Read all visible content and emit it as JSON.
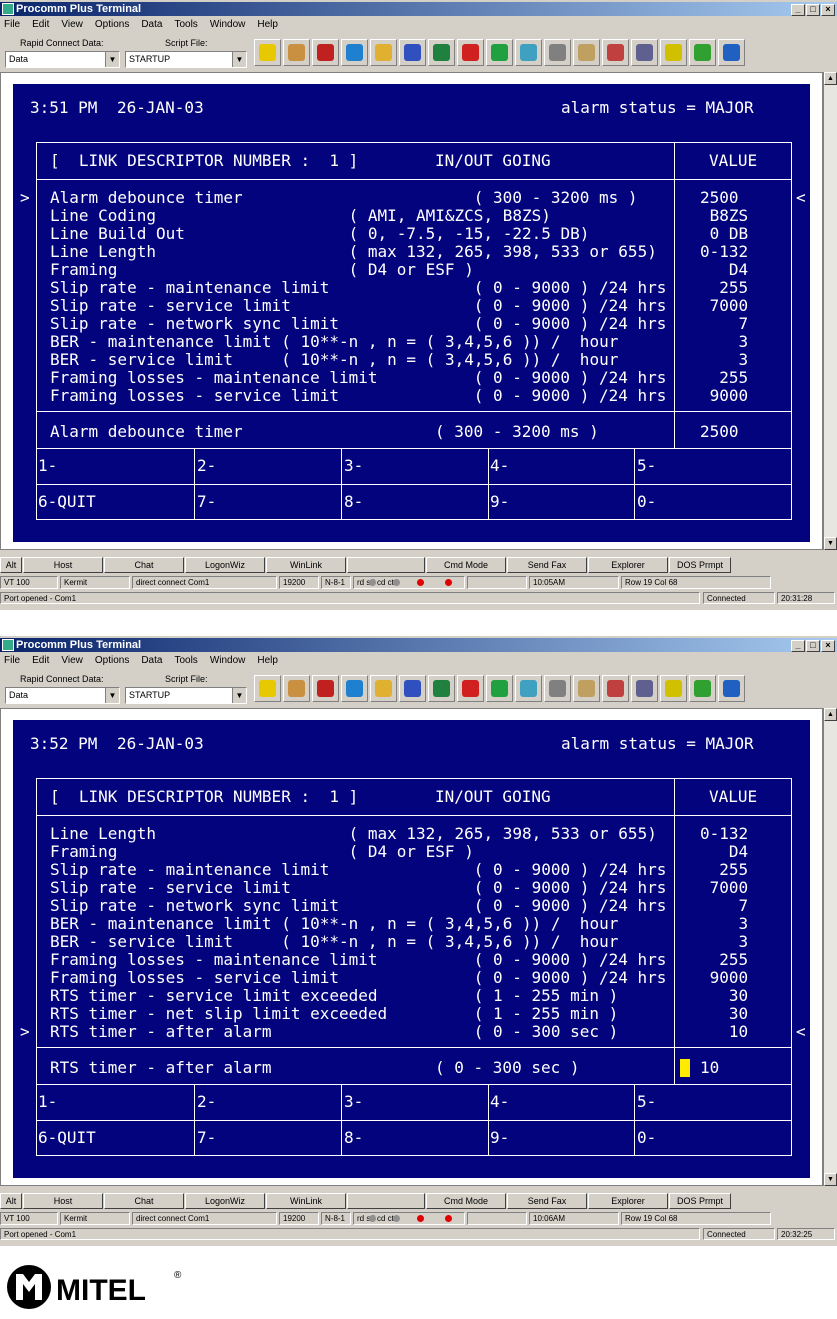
{
  "app": {
    "title": "Procomm Plus Terminal"
  },
  "menu": [
    "File",
    "Edit",
    "View",
    "Options",
    "Data",
    "Tools",
    "Window",
    "Help"
  ],
  "toolbar": {
    "rapid_label": "Rapid Connect Data:",
    "rapid_value": "Data",
    "script_label": "Script File:",
    "script_value": "STARTUP",
    "tools": [
      "run-script-icon",
      "phonebook-icon",
      "mode-icon",
      "upload-icon",
      "download-icon",
      "send-file-icon",
      "capture-icon",
      "dial-icon",
      "terminal-icon",
      "connect-icon",
      "printer-icon",
      "basket-icon",
      "pen-icon",
      "capture-file-icon",
      "meta-key-icon",
      "chat-icon",
      "internet-icon"
    ]
  },
  "colors": {
    "terminal_bg": "#03037e",
    "terminal_fg": "#ffffff",
    "cursor": "#ffeb00",
    "titlebar": "#0a246a"
  },
  "actionbar": {
    "alt_label": "Alt",
    "buttons": [
      "Host",
      "Chat",
      "LogonWiz",
      "WinLink",
      "",
      "Cmd Mode",
      "Send Fax",
      "Explorer",
      "DOS Prmpt"
    ]
  },
  "screens": [
    {
      "time": "3:51 PM",
      "date": "26-JAN-03",
      "alarm_status": "alarm status = MAJOR",
      "header_left": "[  LINK DESCRIPTOR NUMBER :  1 ]",
      "header_mid": "IN/OUT GOING",
      "header_value": "VALUE",
      "marker_left": ">",
      "marker_right": "<",
      "rows": [
        {
          "label": "Alarm debounce timer",
          "range": "                        ( 300 - 3200 ms )",
          "value": "2500"
        },
        {
          "label": "Line Coding",
          "range": "                    ( AMI, AMI&ZCS, B8ZS)",
          "value": " B8ZS"
        },
        {
          "label": "Line Build Out",
          "range": "                 ( 0, -7.5, -15, -22.5 DB)",
          "value": " 0 DB"
        },
        {
          "label": "Line Length",
          "range": "                    ( max 132, 265, 398, 533 or 655)",
          "value": "0-132"
        },
        {
          "label": "Framing",
          "range": "                        ( D4 or ESF )",
          "value": "   D4"
        },
        {
          "label": "Slip rate - maintenance limit",
          "range": "               ( 0 - 9000 ) /24 hrs",
          "value": "  255"
        },
        {
          "label": "Slip rate - service limit",
          "range": "                   ( 0 - 9000 ) /24 hrs",
          "value": " 7000"
        },
        {
          "label": "Slip rate - network sync limit",
          "range": "              ( 0 - 9000 ) /24 hrs",
          "value": "    7"
        },
        {
          "label": "BER - maintenance limit ( 10**-n , n = ( 3,4,5,6 )) /  hour",
          "range": "",
          "value": "    3"
        },
        {
          "label": "BER - service limit     ( 10**-n , n = ( 3,4,5,6 )) /  hour",
          "range": "",
          "value": "    3"
        },
        {
          "label": "Framing losses - maintenance limit",
          "range": "          ( 0 - 9000 ) /24 hrs",
          "value": "  255"
        },
        {
          "label": "Framing losses - service limit",
          "range": "              ( 0 - 9000 ) /24 hrs",
          "value": " 9000"
        }
      ],
      "marker_row": 0,
      "edit_label": "Alarm debounce timer",
      "edit_range": "( 300 - 3200 ms )",
      "edit_value": "2500",
      "show_cursor": false,
      "softkeys": [
        "1-",
        "2-",
        "3-",
        "4-",
        "5-",
        "6-QUIT",
        "7-",
        "8-",
        "9-",
        "0-"
      ],
      "status": {
        "emulation": "VT 100",
        "protocol": "Kermit",
        "connection": "direct connect Com1",
        "baud": "19200",
        "parity": "N-8-1",
        "leds": "rd      sd      cd      cts",
        "clock": "10:05AM",
        "position": "Row 19   Col 68",
        "port": "Port opened - Com1",
        "state": "Connected",
        "elapsed": "20:31:28"
      }
    },
    {
      "time": "3:52 PM",
      "date": "26-JAN-03",
      "alarm_status": "alarm status = MAJOR",
      "header_left": "[  LINK DESCRIPTOR NUMBER :  1 ]",
      "header_mid": "IN/OUT GOING",
      "header_value": "VALUE",
      "marker_left": ">",
      "marker_right": "<",
      "rows": [
        {
          "label": "Line Length",
          "range": "                    ( max 132, 265, 398, 533 or 655)",
          "value": "0-132"
        },
        {
          "label": "Framing",
          "range": "                        ( D4 or ESF )",
          "value": "   D4"
        },
        {
          "label": "Slip rate - maintenance limit",
          "range": "               ( 0 - 9000 ) /24 hrs",
          "value": "  255"
        },
        {
          "label": "Slip rate - service limit",
          "range": "                   ( 0 - 9000 ) /24 hrs",
          "value": " 7000"
        },
        {
          "label": "Slip rate - network sync limit",
          "range": "              ( 0 - 9000 ) /24 hrs",
          "value": "    7"
        },
        {
          "label": "BER - maintenance limit ( 10**-n , n = ( 3,4,5,6 )) /  hour",
          "range": "",
          "value": "    3"
        },
        {
          "label": "BER - service limit     ( 10**-n , n = ( 3,4,5,6 )) /  hour",
          "range": "",
          "value": "    3"
        },
        {
          "label": "Framing losses - maintenance limit",
          "range": "          ( 0 - 9000 ) /24 hrs",
          "value": "  255"
        },
        {
          "label": "Framing losses - service limit",
          "range": "              ( 0 - 9000 ) /24 hrs",
          "value": " 9000"
        },
        {
          "label": "RTS timer - service limit exceeded",
          "range": "          ( 1 - 255 min )",
          "value": "   30"
        },
        {
          "label": "RTS timer - net slip limit exceeded",
          "range": "         ( 1 - 255 min )",
          "value": "   30"
        },
        {
          "label": "RTS timer - after alarm",
          "range": "                     ( 0 - 300 sec )",
          "value": "   10"
        }
      ],
      "marker_row": 11,
      "edit_label": "RTS timer - after alarm",
      "edit_range": "( 0 - 300 sec )",
      "edit_value": "10",
      "show_cursor": true,
      "softkeys": [
        "1-",
        "2-",
        "3-",
        "4-",
        "5-",
        "6-QUIT",
        "7-",
        "8-",
        "9-",
        "0-"
      ],
      "status": {
        "emulation": "VT 100",
        "protocol": "Kermit",
        "connection": "direct connect Com1",
        "baud": "19200",
        "parity": "N-8-1",
        "leds": "rd      sd      cd      cts",
        "clock": "10:06AM",
        "position": "Row 19   Col 68",
        "port": "Port opened - Com1",
        "state": "Connected",
        "elapsed": "20:32:25"
      }
    }
  ],
  "logo": {
    "text": "MITEL",
    "mark": "®"
  }
}
